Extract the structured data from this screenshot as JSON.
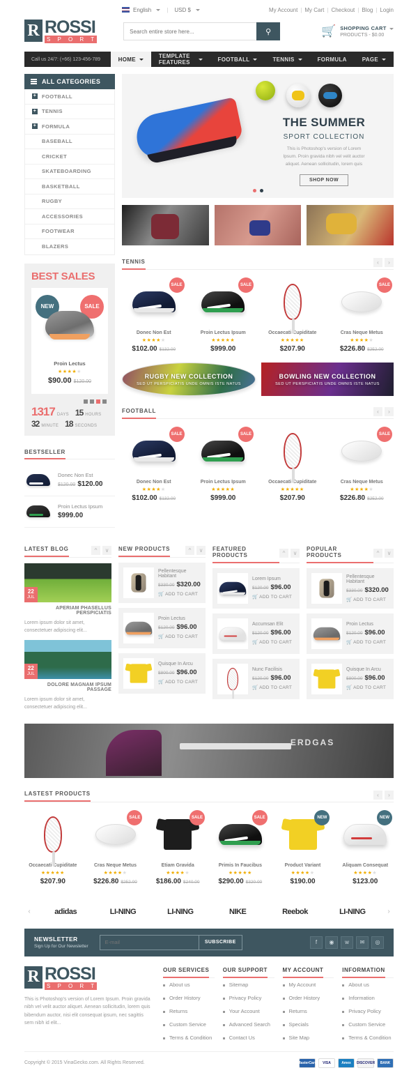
{
  "topbar": {
    "language": "English",
    "currency": "USD $",
    "links": [
      "My Account",
      "My Cart",
      "Checkout",
      "Blog",
      "Login"
    ]
  },
  "header": {
    "logo_initial": "R",
    "logo_name": "ROSSI",
    "logo_sub": "S P O R T",
    "search_placeholder": "Search entire store here...",
    "search_value": "",
    "search_icon": "search-icon",
    "cart_icon": "basket-icon",
    "cart_title": "SHOPPING CART",
    "cart_summary": "PRODUCTS - $0.00"
  },
  "nav": {
    "callus": "Call us 24/7: (+66) 123-456-789",
    "items": [
      {
        "label": "HOME",
        "caret": true,
        "active": true
      },
      {
        "label": "TEMPLATE FEATURES",
        "caret": true,
        "active": false
      },
      {
        "label": "FOOTBALL",
        "caret": true,
        "active": false
      },
      {
        "label": "TENNIS",
        "caret": true,
        "active": false
      },
      {
        "label": "FORMULA",
        "caret": false,
        "active": false
      },
      {
        "label": "PAGE",
        "caret": true,
        "active": false
      }
    ]
  },
  "categories": {
    "title": "ALL CATEGORIES",
    "items": [
      {
        "label": "FOOTBALL",
        "expandable": true
      },
      {
        "label": "TENNIS",
        "expandable": true
      },
      {
        "label": "FORMULA",
        "expandable": true
      },
      {
        "label": "BASEBALL",
        "expandable": false
      },
      {
        "label": "CRICKET",
        "expandable": false
      },
      {
        "label": "SKATEBOARDING",
        "expandable": false
      },
      {
        "label": "BASKETBALL",
        "expandable": false
      },
      {
        "label": "RUGBY",
        "expandable": false
      },
      {
        "label": "ACCESSORIES",
        "expandable": false
      },
      {
        "label": "FOOTWEAR",
        "expandable": false
      },
      {
        "label": "BLAZERS",
        "expandable": false
      }
    ]
  },
  "hero": {
    "title": "THE SUMMER",
    "subtitle": "SPORT COLLECTION",
    "description": "This is Photoshop's version of Lorem Ipsum. Proin gravida nibh vel velit auctor aliquet. Aenean sollicitudin, lorem quis",
    "button": "SHOP NOW"
  },
  "bestsales": {
    "title": "BEST SALES",
    "badge_new": "NEW",
    "badge_sale": "SALE",
    "product_name": "Proin Lectus",
    "stars": 4,
    "price": "$90.00",
    "old_price": "$120.00",
    "countdown": {
      "days_value": "1317",
      "days_label": "DAYS",
      "hours_value": "15",
      "hours_label": "HOURS",
      "minute_value": "32",
      "minute_label": "MINUTE",
      "seconds_value": "18",
      "seconds_label": "SECONDS"
    }
  },
  "bestseller": {
    "title": "BESTSELLER",
    "items": [
      {
        "name": "Donec Non Est",
        "price": "$120.00",
        "old_price": "$120.00",
        "art": "navy"
      },
      {
        "name": "Proin Lectus Ipsum",
        "price": "$999.00",
        "old_price": "",
        "art": "black"
      }
    ]
  },
  "tennis": {
    "title": "TENNIS",
    "products": [
      {
        "name": "Donec Non Est",
        "price": "$102.00",
        "old_price": "$132.00",
        "badge": "SALE",
        "stars": 4,
        "art": "shoe-navy"
      },
      {
        "name": "Proin Lectus Ipsum",
        "price": "$999.00",
        "old_price": "",
        "badge": "SALE",
        "stars": 5,
        "art": "shoe-black"
      },
      {
        "name": "Occaecati Cupiditate",
        "price": "$207.90",
        "old_price": "",
        "badge": "",
        "stars": 5,
        "art": "racket"
      },
      {
        "name": "Cras Neque Metus",
        "price": "$226.80",
        "old_price": "$252.00",
        "badge": "SALE",
        "stars": 4,
        "art": "rugby"
      }
    ]
  },
  "collections": [
    {
      "title": "RUGBY NEW COLLECTION",
      "subtitle": "SED UT PERSPICIATIS UNDE OMNIS ISTE NATUS",
      "theme": "rugby"
    },
    {
      "title": "BOWLING NEW COLLECTION",
      "subtitle": "SED UT PERSPICIATIS UNDE OMNIS ISTE NATUS",
      "theme": "bowling"
    }
  ],
  "football": {
    "title": "FOOTBALL",
    "products": [
      {
        "name": "Donec Non Est",
        "price": "$102.00",
        "old_price": "$132.00",
        "badge": "SALE",
        "stars": 4,
        "art": "shoe-navy"
      },
      {
        "name": "Proin Lectus Ipsum",
        "price": "$999.00",
        "old_price": "",
        "badge": "SALE",
        "stars": 5,
        "art": "shoe-black"
      },
      {
        "name": "Occaecati Cupiditate",
        "price": "$207.90",
        "old_price": "",
        "badge": "",
        "stars": 5,
        "art": "racket"
      },
      {
        "name": "Cras Neque Metus",
        "price": "$226.80",
        "old_price": "$252.00",
        "badge": "SALE",
        "stars": 4,
        "art": "rugby"
      }
    ]
  },
  "blog": {
    "title": "LATEST BLOG",
    "posts": [
      {
        "day": "22",
        "month": "JUL",
        "title": "APERIAM PHASELLUS PERSPICIATIS",
        "excerpt": "Lorem ipsum dolor sit amet, consectetuer adipiscing elit..."
      },
      {
        "day": "22",
        "month": "JUL",
        "title": "DOLORE MAGNAM IPSUM PASSAGE",
        "excerpt": "Lorem ipsum dolor sit amet, consectetuer adipiscing elit..."
      }
    ]
  },
  "new_products": {
    "title": "NEW PRODUCTS",
    "add_to_cart": "ADD TO CART",
    "items": [
      {
        "name": "Pellentesque Habitant",
        "price": "$320.00",
        "old_price": "$330.00",
        "art": "bag"
      },
      {
        "name": "Proin Lectus",
        "price": "$96.00",
        "old_price": "$120.00",
        "art": "shoe-gray"
      },
      {
        "name": "Quisque In Arcu",
        "price": "$96.00",
        "old_price": "$800.00",
        "art": "shirt-yellow"
      }
    ]
  },
  "featured_products": {
    "title": "FEATURED PRODUCTS",
    "add_to_cart": "ADD TO CART",
    "items": [
      {
        "name": "Lorem Ipsum",
        "price": "$96.00",
        "old_price": "$120.00",
        "art": "shoe-navy"
      },
      {
        "name": "Accumsan Elit",
        "price": "$96.00",
        "old_price": "$120.00",
        "art": "shoe-white"
      },
      {
        "name": "Nunc Facilisis",
        "price": "$96.00",
        "old_price": "$120.00",
        "art": "racket"
      }
    ]
  },
  "popular_products": {
    "title": "POPULAR PRODUCTS",
    "add_to_cart": "ADD TO CART",
    "items": [
      {
        "name": "Pellentesque Habitant",
        "price": "$320.00",
        "old_price": "$330.00",
        "art": "bag"
      },
      {
        "name": "Proin Lectus",
        "price": "$96.00",
        "old_price": "$120.00",
        "art": "shoe-gray"
      },
      {
        "name": "Quisque In Arcu",
        "price": "$96.00",
        "old_price": "$800.00",
        "art": "shirt-yellow"
      }
    ]
  },
  "wide_banner": {
    "text": "ERDGAS"
  },
  "latest_products": {
    "title": "LASTEST PRODUCTS",
    "products": [
      {
        "name": "Occaecati Cupiditate",
        "price": "$207.90",
        "old_price": "",
        "badge": "",
        "stars": 5,
        "art": "racket"
      },
      {
        "name": "Cras Neque Metus",
        "price": "$226.80",
        "old_price": "$252.00",
        "badge": "SALE",
        "stars": 4,
        "art": "rugby"
      },
      {
        "name": "Etiam Gravida",
        "price": "$186.00",
        "old_price": "$240.00",
        "badge": "SALE",
        "stars": 4,
        "art": "shirt-black"
      },
      {
        "name": "Primis In Faucibus",
        "price": "$290.00",
        "old_price": "$320.00",
        "badge": "SALE",
        "stars": 5,
        "art": "shoe-black"
      },
      {
        "name": "Product Variant",
        "price": "$190.00",
        "old_price": "",
        "badge": "NEW",
        "stars": 4,
        "art": "shirt-yellow"
      },
      {
        "name": "Aliquam Consequat",
        "price": "$123.00",
        "old_price": "",
        "badge": "NEW",
        "stars": 4,
        "art": "shoe-white"
      }
    ]
  },
  "brands": [
    "adidas",
    "LI-NING",
    "LI-NING",
    "NIKE",
    "Reebok",
    "LI-NING"
  ],
  "newsletter": {
    "title": "NEWSLETTER",
    "subtitle": "Sign Up for Our Newsletter",
    "placeholder": "E-mail",
    "value": "",
    "subscribe": "SUBSCRIBE",
    "socials": [
      "facebook-icon",
      "rss-icon",
      "twitter-icon",
      "skype-icon",
      "dribbble-icon"
    ]
  },
  "footer": {
    "about_text": "This is Photoshop's version of Lorem Ipsum. Proin gravida nibh vel velit auctor aliquet. Aenean sollicitudin, lorem quis bibendum auctor, nisi elit consequat ipsum, nec sagittis sem nibh id elit...",
    "columns": [
      {
        "title": "OUR SERVICES",
        "links": [
          "About us",
          "Order History",
          "Returns",
          "Custom Service",
          "Terms & Condition"
        ]
      },
      {
        "title": "OUR SUPPORT",
        "links": [
          "Sitemap",
          "Privacy Policy",
          "Your Account",
          "Advanced Search",
          "Contact Us"
        ]
      },
      {
        "title": "MY ACCOUNT",
        "links": [
          "My Account",
          "Order History",
          "Returns",
          "Specials",
          "Site Map"
        ]
      },
      {
        "title": "INFORMATION",
        "links": [
          "About us",
          "Information",
          "Privacy Policy",
          "Custom Service",
          "Terms & Condition"
        ]
      }
    ],
    "copyright": "Copyright © 2015 VinaGecko.com. All Rights Reserved.",
    "cards": [
      {
        "label": "MasterCard",
        "color": "#2a63ab"
      },
      {
        "label": "VISA",
        "color": "#ffffff"
      },
      {
        "label": "Amex",
        "color": "#1a7fc1"
      },
      {
        "label": "DISCOVER",
        "color": "#f4f4f4"
      },
      {
        "label": "BANK",
        "color": "#2f6fb5"
      }
    ]
  },
  "colors": {
    "accent": "#ea6e6e",
    "dark": "#3e5660",
    "nav": "#2a2a2a"
  }
}
